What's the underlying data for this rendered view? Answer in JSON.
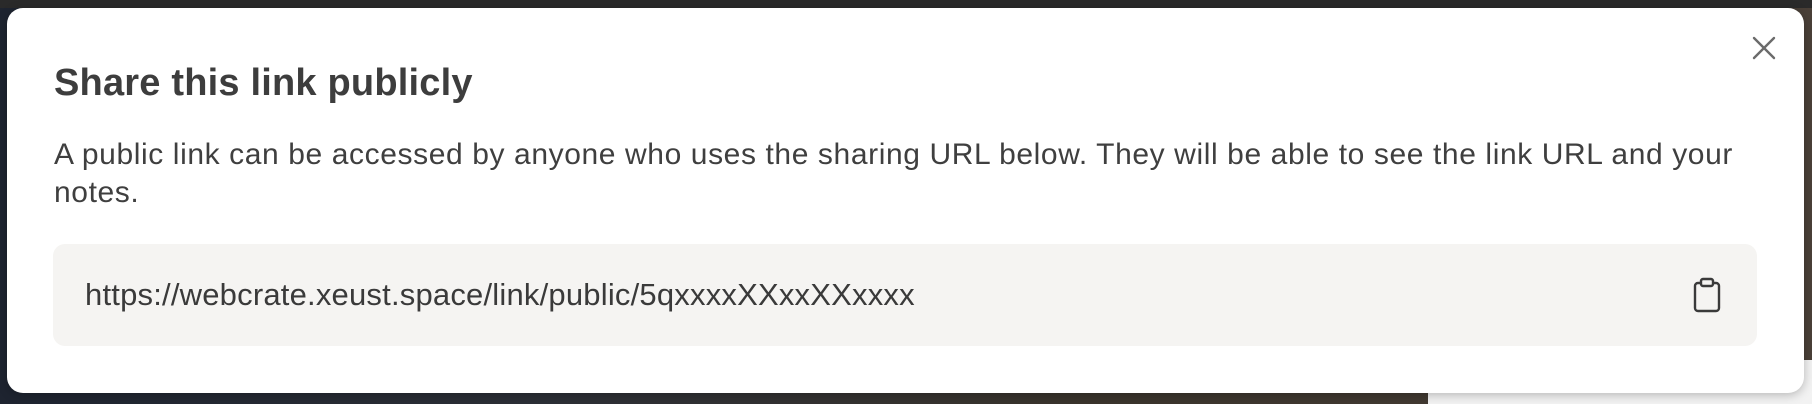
{
  "dialog": {
    "title": "Share this link publicly",
    "description": "A public link can be accessed by anyone who uses the sharing URL below. They will be able to see the link URL and your notes.",
    "public_url": "https://webcrate.xeust.space/link/public/5qxxxxXXxxXXxxxx",
    "close_icon": "close-icon",
    "copy_icon": "clipboard-icon"
  },
  "colors": {
    "title": "#3d3d3d",
    "text": "#3f3f3f",
    "link_box_bg": "#f5f4f2",
    "modal_bg": "#ffffff"
  }
}
